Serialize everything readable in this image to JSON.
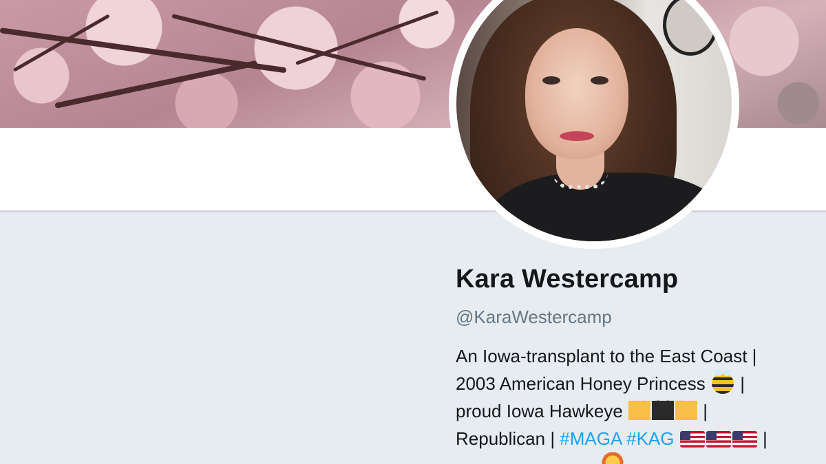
{
  "profile": {
    "name": "Kara Westercamp",
    "handle": "@KaraWestercamp",
    "bio": {
      "line1": "An Iowa-transplant to the East Coast |",
      "line2": "2003 American Honey Princess",
      "line2_end": " |",
      "line3_start": "proud Iowa Hawkeye ",
      "line3_end": " |",
      "line4_start": "Republican | ",
      "hashtag1": "#MAGA",
      "space": " ",
      "hashtag2": "#KAG",
      "line4_end": " |"
    }
  },
  "icons": {
    "bee": "honeybee-icon",
    "heart_gold": "yellow-heart-icon",
    "heart_black": "black-heart-icon",
    "flag": "us-flag-icon"
  },
  "colors": {
    "background": "#e6ecf0",
    "name": "#14171a",
    "handle": "#657786",
    "hashtag": "#1da1f2"
  }
}
